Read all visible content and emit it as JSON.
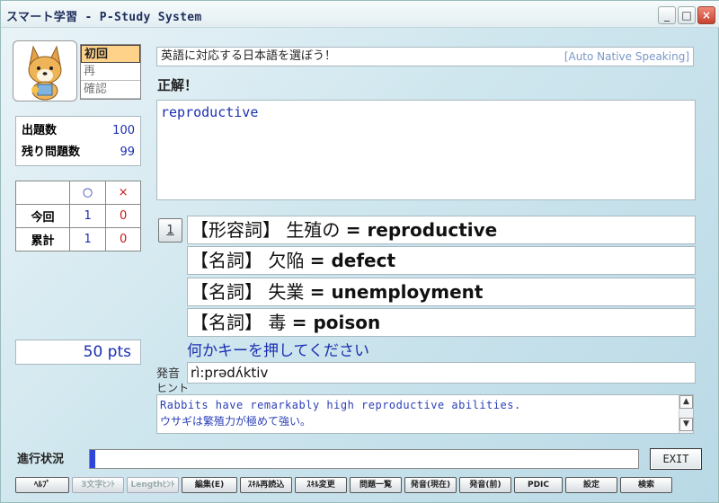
{
  "window": {
    "title": "スマート学習 - P-Study System",
    "controls": {
      "minimize": "_",
      "maximize": "□",
      "close": "×"
    }
  },
  "mode": {
    "items": [
      {
        "label": "初回",
        "active": true
      },
      {
        "label": "再",
        "active": false
      },
      {
        "label": "確認",
        "active": false
      }
    ]
  },
  "stats": {
    "total_label": "出題数",
    "total_value": "100",
    "remaining_label": "残り問題数",
    "remaining_value": "99"
  },
  "score": {
    "o_symbol": "○",
    "x_symbol": "×",
    "current_label": "今回",
    "current_o": "1",
    "current_x": "0",
    "total_label": "累計",
    "total_o": "1",
    "total_x": "0"
  },
  "points": "50 pts",
  "question": {
    "instruction": "英語に対応する日本語を選ぼう！",
    "auto_speaking": "[Auto Native Speaking]",
    "result": "正解！",
    "answer_text": "reproductive"
  },
  "number_button": "1",
  "choices": [
    {
      "pos": "【形容詞】",
      "jp": "生殖の",
      "en": "= reproductive"
    },
    {
      "pos": "【名詞】",
      "jp": "欠陥",
      "en": "= defect"
    },
    {
      "pos": "【名詞】",
      "jp": "失業",
      "en": "= unemployment"
    },
    {
      "pos": "【名詞】",
      "jp": "毒",
      "en": "= poison"
    }
  ],
  "press_key": "何かキーを押してください",
  "pronunciation": {
    "label": "発音",
    "hint_label": "ヒント",
    "value": "rì:prədʌ́ktiv"
  },
  "example": {
    "en": "Rabbits have remarkably high reproductive abilities.",
    "jp": "ウサギは繁殖力が極めて強い。"
  },
  "progress": {
    "label": "進行状況",
    "fraction": 0.01
  },
  "exit_label": "EXIT",
  "toolbar": [
    {
      "label": "ﾍﾙﾌﾟ",
      "enabled": true
    },
    {
      "label": "3文字ﾋﾝﾄ",
      "enabled": false
    },
    {
      "label": "Lengthﾋﾝﾄ",
      "enabled": false
    },
    {
      "label": "編集(E)",
      "enabled": true
    },
    {
      "label": "ｽｷﾙ再読込",
      "enabled": true
    },
    {
      "label": "ｽｷﾙ変更",
      "enabled": true
    },
    {
      "label": "問題一覧",
      "enabled": true
    },
    {
      "label": "発音(現在)",
      "enabled": true
    },
    {
      "label": "発音(前)",
      "enabled": true
    },
    {
      "label": "PDIC",
      "enabled": true
    },
    {
      "label": "設定",
      "enabled": true
    },
    {
      "label": "検索",
      "enabled": true
    }
  ],
  "colors": {
    "accent": "#1a2fb0",
    "progress_fill": "#3046d8",
    "mode_active": "#ffd28a",
    "wrong": "#c81818"
  }
}
